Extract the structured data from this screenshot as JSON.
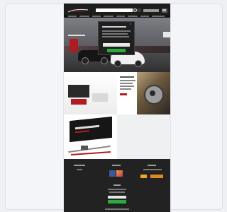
{
  "colors": {
    "header_bg": "#1d1d1d",
    "accent_red": "#b31b22",
    "signup_green": "#2bab3a",
    "footer_bg": "#222222"
  },
  "header": {
    "logo_icon": "brand-logo",
    "search_icon": "search-icon",
    "cart_icon": "cart-icon"
  },
  "hero": {
    "popup_close_icon": "close-icon"
  },
  "footer": {
    "payment_icons": [
      "card-icon",
      "card-icon"
    ],
    "social_icons": [
      "facebook-icon",
      "instagram-icon"
    ]
  }
}
